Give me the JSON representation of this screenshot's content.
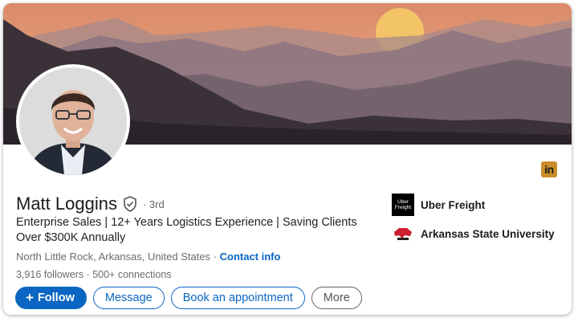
{
  "profile": {
    "name": "Matt Loggins",
    "degree": "· 3rd",
    "headline": "Enterprise Sales | 12+ Years Logistics Experience | Saving Clients Over $300K Annually",
    "location": "North Little Rock, Arkansas, United States ·",
    "contact_link": "Contact info",
    "followers": "3,916 followers",
    "connections": "· 500+ connections"
  },
  "actions": {
    "follow_label": "Follow",
    "message_label": "Message",
    "appointment_label": "Book an appointment",
    "more_label": "More"
  },
  "organizations": [
    {
      "name": "Uber Freight",
      "logo_text": "Uber Freight",
      "icon": "uber-freight-logo"
    },
    {
      "name": "Arkansas State University",
      "icon": "arkansas-state-logo"
    }
  ],
  "badge": {
    "text": "in",
    "icon": "linkedin-icon"
  },
  "colors": {
    "accent": "#0a66c2",
    "linkedin_badge": "#c98e2a"
  }
}
